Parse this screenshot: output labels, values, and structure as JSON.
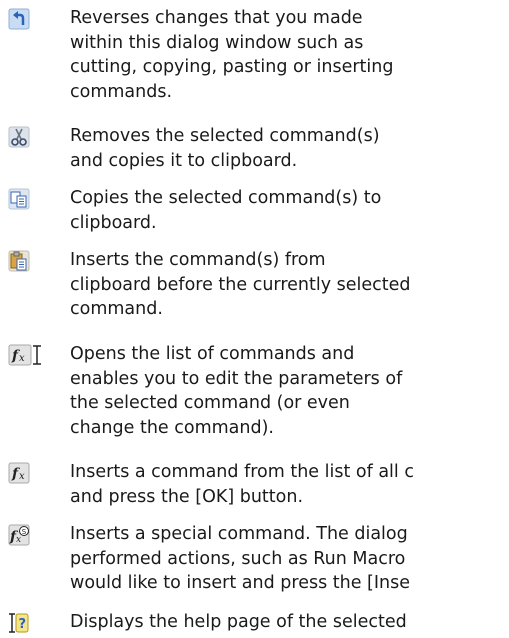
{
  "items": [
    {
      "icon": "undo-icon",
      "lines": [
        "Reverses changes that you made",
        "within this dialog window such as",
        "cutting, copying, pasting or inserting",
        "commands."
      ]
    },
    {
      "icon": "cut-icon",
      "lines": [
        "Removes the selected command(s)",
        "and copies it to clipboard."
      ]
    },
    {
      "icon": "copy-icon",
      "lines": [
        "Copies the selected command(s) to",
        "clipboard."
      ]
    },
    {
      "icon": "paste-icon",
      "lines": [
        "Inserts the command(s) from",
        "clipboard before the currently selected",
        "command."
      ]
    },
    {
      "icon": "edit-function-icon",
      "lines": [
        "Opens the list of commands and",
        "enables you to edit the parameters of",
        "the selected command (or even",
        "change the command)."
      ]
    },
    {
      "icon": "insert-function-icon",
      "lines": [
        "Inserts a command from the list of all c",
        "and press the [OK] button."
      ]
    },
    {
      "icon": "special-command-icon",
      "lines": [
        "Inserts a special command. The dialog",
        "performed actions, such as Run Macro",
        "would like to insert and press the [Inse"
      ]
    },
    {
      "icon": "help-icon",
      "lines": [
        "Displays the help page of the selected"
      ]
    }
  ]
}
